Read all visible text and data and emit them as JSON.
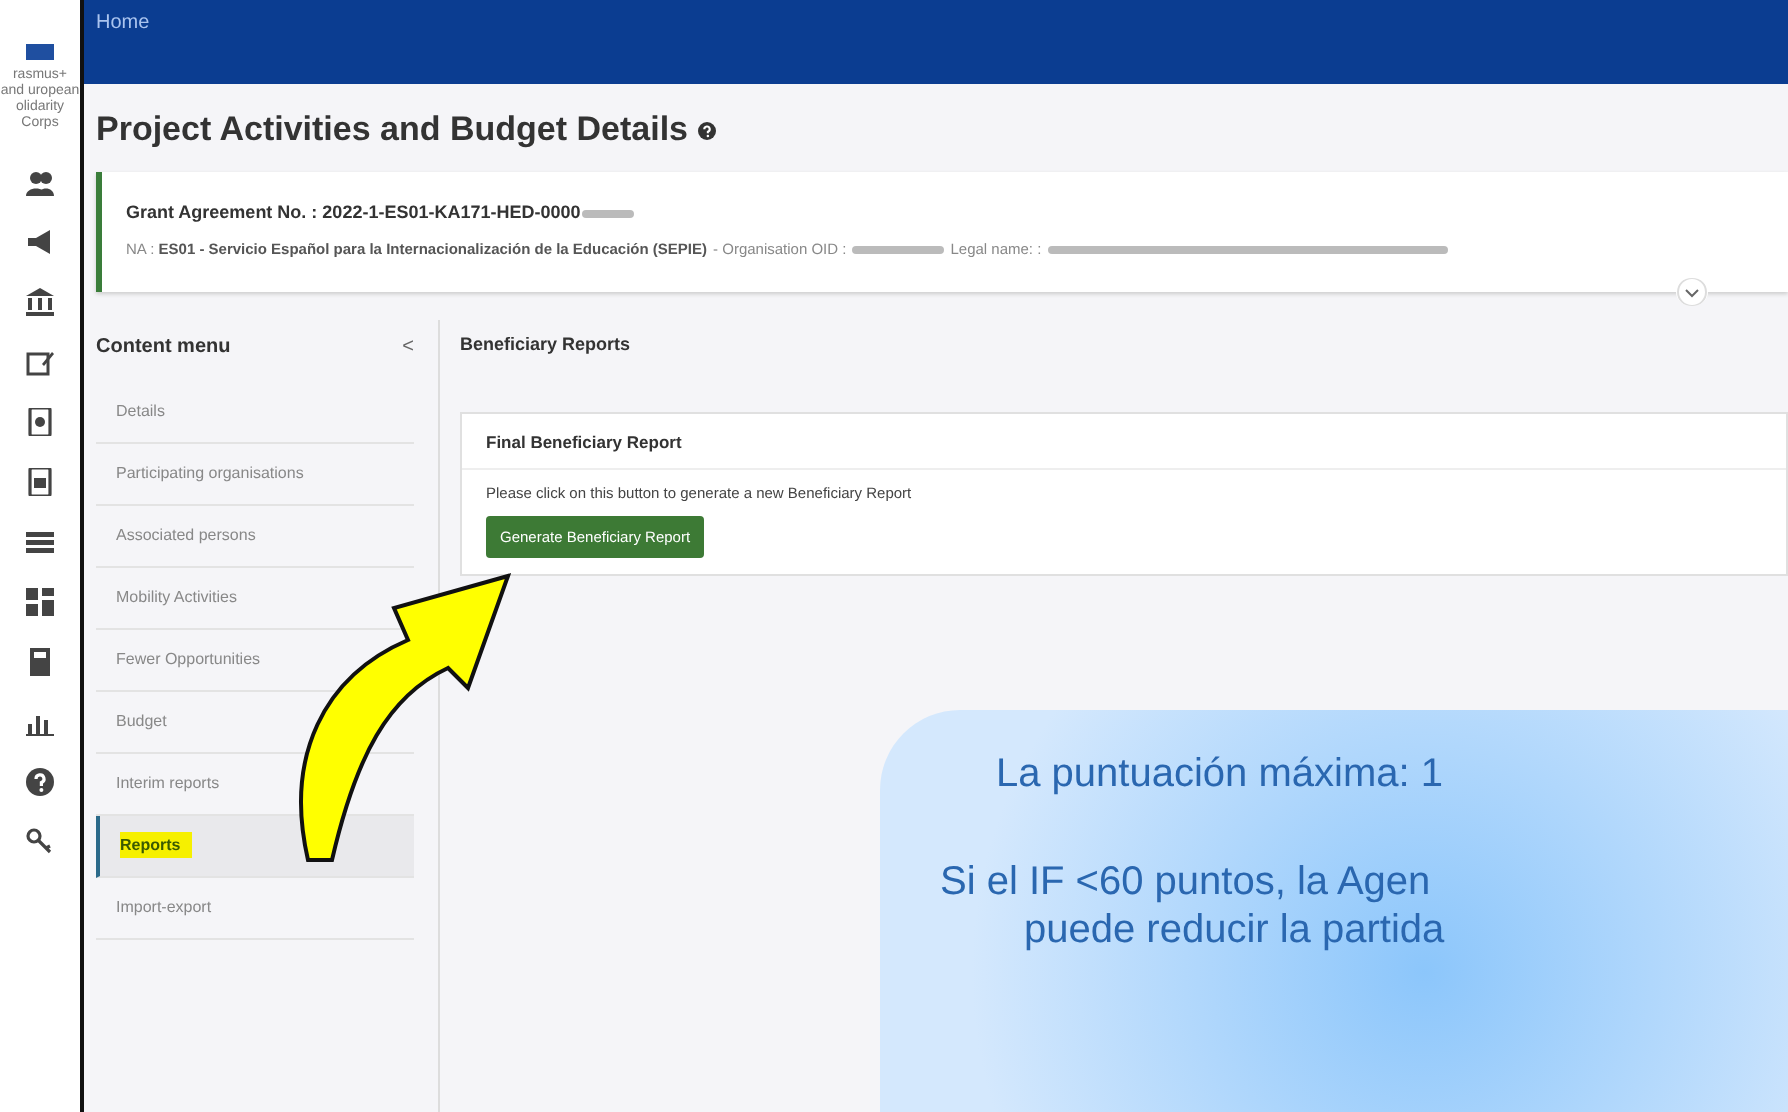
{
  "logo_text": "rasmus+ and uropean olidarity Corps",
  "top_bar": {
    "title": "Home"
  },
  "page_title": "Project Activities and Budget Details",
  "grant": {
    "label": "Grant Agreement No. :",
    "number": "2022-1-ES01-KA171-HED-0000",
    "na_label": "NA :",
    "na_value": "ES01 - Servicio Español para la Internacionalización de la Educación (SEPIE)",
    "oid_label": "- Organisation OID :",
    "legal_label": "Legal name: :"
  },
  "content_menu": {
    "title": "Content menu",
    "collapse": "<",
    "items": [
      {
        "label": "Details",
        "selected": false
      },
      {
        "label": "Participating organisations",
        "selected": false
      },
      {
        "label": "Associated persons",
        "selected": false
      },
      {
        "label": "Mobility Activities",
        "selected": false
      },
      {
        "label": "Fewer Opportunities",
        "selected": false
      },
      {
        "label": "Budget",
        "selected": false
      },
      {
        "label": "Interim reports",
        "selected": false
      },
      {
        "label": "Reports",
        "selected": true
      },
      {
        "label": "Import-export",
        "selected": false
      }
    ]
  },
  "section_title": "Beneficiary Reports",
  "report_card": {
    "title": "Final Beneficiary Report",
    "text": "Please click on this button to generate a new Beneficiary Report",
    "button": "Generate Beneficiary Report"
  },
  "callout": {
    "lines": [
      "La puntuación máxima: 1",
      "Si el IF <60 puntos, la Agen",
      "puede reducir la partida"
    ]
  }
}
